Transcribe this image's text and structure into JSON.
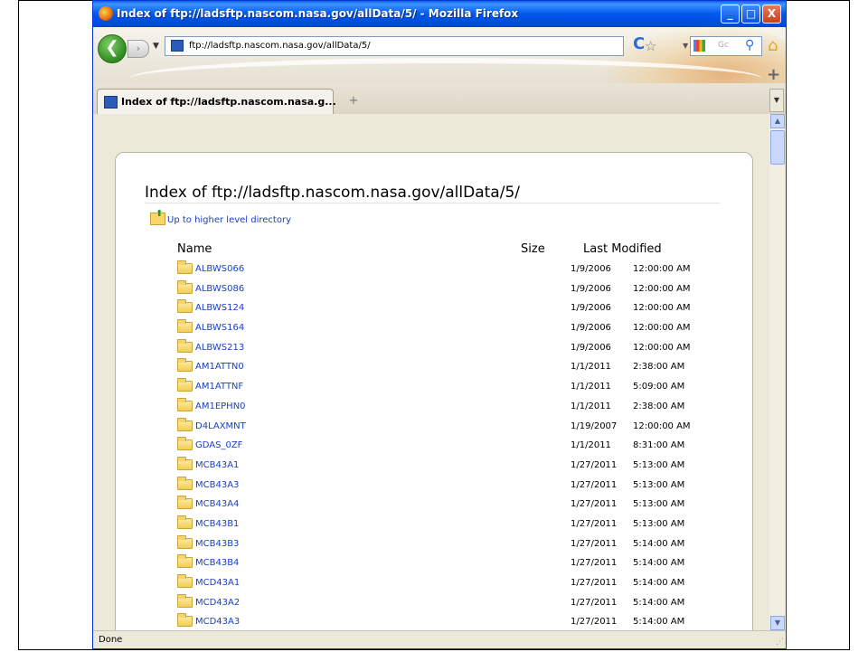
{
  "window": {
    "title": "Index of ftp://ladsftp.nascom.nasa.gov/allData/5/ - Mozilla Firefox",
    "minimize_glyph": "_",
    "maximize_glyph": "□",
    "close_glyph": "X"
  },
  "navbar": {
    "back_glyph": "❮",
    "forward_glyph": "›",
    "url": "ftp://ladsftp.nascom.nasa.gov/allData/5/",
    "search_placeholder": "Gc",
    "plus_glyph": "+"
  },
  "tabs": [
    {
      "label": "Index of ftp://ladsftp.nascom.nasa.g...",
      "active": true
    }
  ],
  "newtab_glyph": "+",
  "status": {
    "text": "Done"
  },
  "page": {
    "heading": "Index of ftp://ladsftp.nascom.nasa.gov/allData/5/",
    "up_link": "Up to higher level directory",
    "columns": {
      "name": "Name",
      "size": "Size",
      "modified": "Last Modified"
    },
    "entries": [
      {
        "name": "ALBWS066",
        "date": "1/9/2006",
        "time": "12:00:00 AM"
      },
      {
        "name": "ALBWS086",
        "date": "1/9/2006",
        "time": "12:00:00 AM"
      },
      {
        "name": "ALBWS124",
        "date": "1/9/2006",
        "time": "12:00:00 AM"
      },
      {
        "name": "ALBWS164",
        "date": "1/9/2006",
        "time": "12:00:00 AM"
      },
      {
        "name": "ALBWS213",
        "date": "1/9/2006",
        "time": "12:00:00 AM"
      },
      {
        "name": "AM1ATTN0",
        "date": "1/1/2011",
        "time": "2:38:00 AM"
      },
      {
        "name": "AM1ATTNF",
        "date": "1/1/2011",
        "time": "5:09:00 AM"
      },
      {
        "name": "AM1EPHN0",
        "date": "1/1/2011",
        "time": "2:38:00 AM"
      },
      {
        "name": "D4LAXMNT",
        "date": "1/19/2007",
        "time": "12:00:00 AM"
      },
      {
        "name": "GDAS_0ZF",
        "date": "1/1/2011",
        "time": "8:31:00 AM"
      },
      {
        "name": "MCB43A1",
        "date": "1/27/2011",
        "time": "5:13:00 AM"
      },
      {
        "name": "MCB43A3",
        "date": "1/27/2011",
        "time": "5:13:00 AM"
      },
      {
        "name": "MCB43A4",
        "date": "1/27/2011",
        "time": "5:13:00 AM"
      },
      {
        "name": "MCB43B1",
        "date": "1/27/2011",
        "time": "5:13:00 AM"
      },
      {
        "name": "MCB43B3",
        "date": "1/27/2011",
        "time": "5:14:00 AM"
      },
      {
        "name": "MCB43B4",
        "date": "1/27/2011",
        "time": "5:14:00 AM"
      },
      {
        "name": "MCD43A1",
        "date": "1/27/2011",
        "time": "5:14:00 AM"
      },
      {
        "name": "MCD43A2",
        "date": "1/27/2011",
        "time": "5:14:00 AM"
      },
      {
        "name": "MCD43A3",
        "date": "1/27/2011",
        "time": "5:14:00 AM"
      }
    ]
  }
}
